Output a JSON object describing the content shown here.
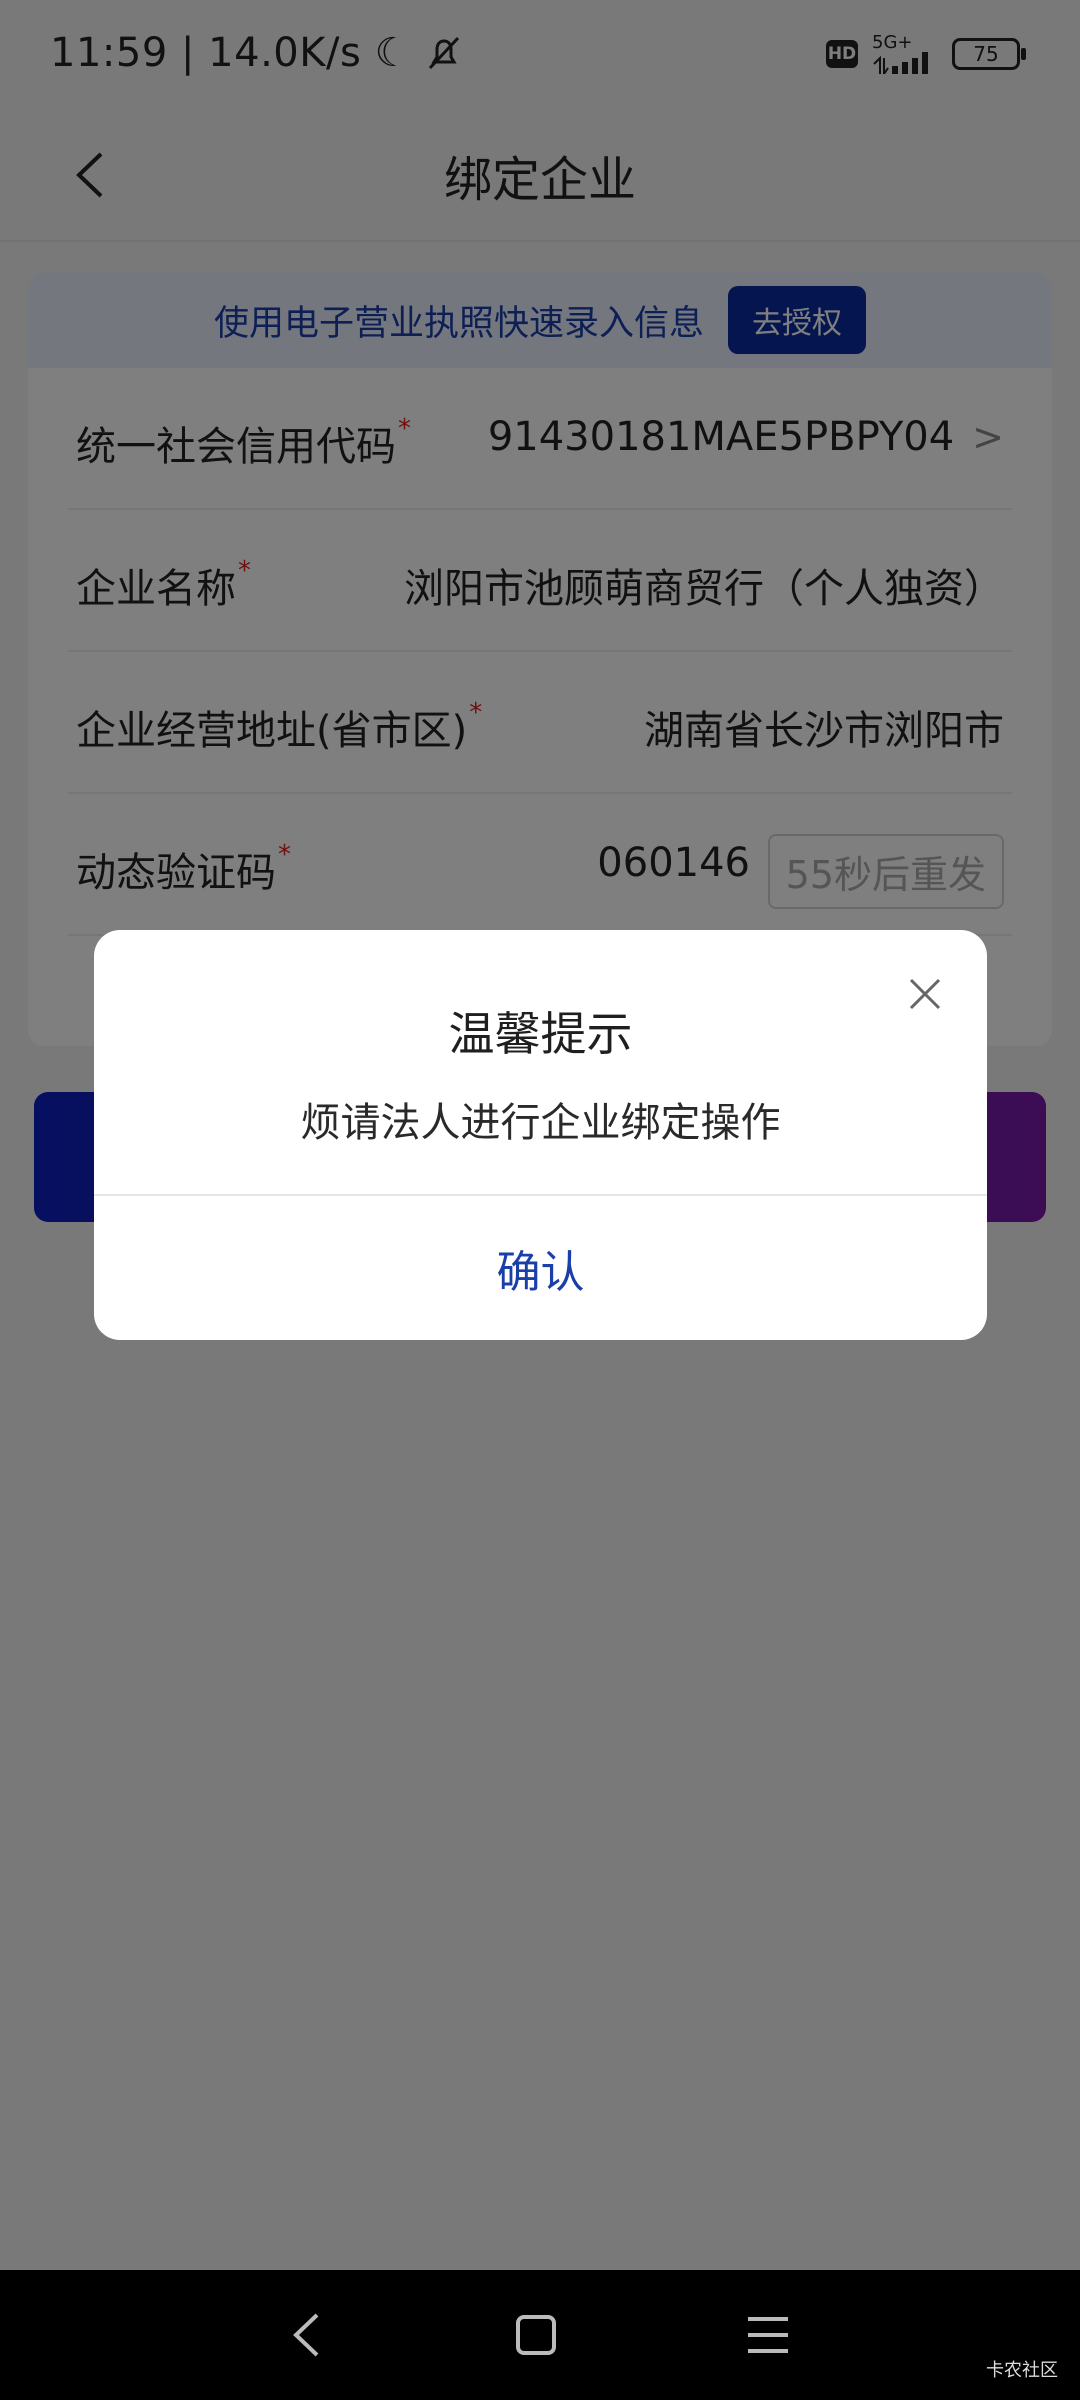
{
  "status_bar": {
    "time": "11:59 | 14.0K/s",
    "hd_label": "HD",
    "network_label": "5G+",
    "battery": "75"
  },
  "header": {
    "title": "绑定企业"
  },
  "banner": {
    "text": "使用电子营业执照快速录入信息",
    "button": "去授权"
  },
  "form": {
    "fields": [
      {
        "label": "统一社会信用代码",
        "value": "91430181MAE5PBPY04"
      },
      {
        "label": "企业名称",
        "value": "浏阳市池顾萌商贸行（个人独资）"
      },
      {
        "label": "企业经营地址(省市区)",
        "value": "湖南省长沙市浏阳市"
      },
      {
        "label": "动态验证码",
        "value": "060146"
      }
    ],
    "required_mark": "*",
    "resend_label": "55秒后重发"
  },
  "dialog": {
    "title": "温馨提示",
    "message": "烦请法人进行企业绑定操作",
    "confirm": "确认"
  },
  "watermark": "卡农社区",
  "colors": {
    "accent": "#1a3fa8",
    "button_dark": "#0b2aa0",
    "required": "#e02020"
  }
}
